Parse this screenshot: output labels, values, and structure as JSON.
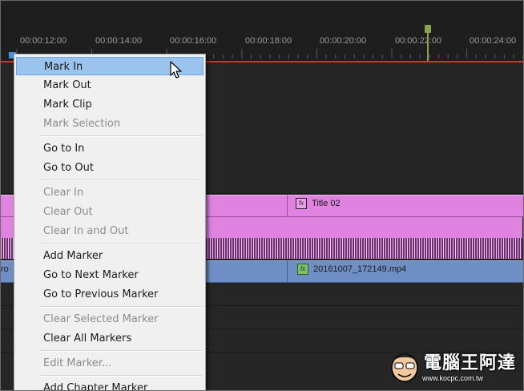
{
  "ruler": {
    "timecodes": [
      "00:00:12:00",
      "00:00:14:00",
      "00:00:16:00",
      "00:00:18:00",
      "00:00:20:00",
      "00:00:22:00",
      "00:00:24:00"
    ]
  },
  "clips": {
    "title": {
      "label": "Title 02",
      "fx": "fx"
    },
    "video": {
      "label": "20161007_172149.mp4",
      "fx": "fx",
      "left_stub": "ro"
    }
  },
  "menu": {
    "items": [
      {
        "label": "Mark In",
        "state": "highlighted"
      },
      {
        "label": "Mark Out",
        "state": "enabled"
      },
      {
        "label": "Mark Clip",
        "state": "enabled"
      },
      {
        "label": "Mark Selection",
        "state": "disabled"
      },
      {
        "label": "Go to In",
        "state": "enabled"
      },
      {
        "label": "Go to Out",
        "state": "enabled"
      },
      {
        "label": "Clear In",
        "state": "disabled"
      },
      {
        "label": "Clear Out",
        "state": "disabled"
      },
      {
        "label": "Clear In and Out",
        "state": "disabled"
      },
      {
        "label": "Add Marker",
        "state": "enabled"
      },
      {
        "label": "Go to Next Marker",
        "state": "enabled"
      },
      {
        "label": "Go to Previous Marker",
        "state": "enabled"
      },
      {
        "label": "Clear Selected Marker",
        "state": "disabled"
      },
      {
        "label": "Clear All Markers",
        "state": "enabled"
      },
      {
        "label": "Edit Marker...",
        "state": "disabled"
      },
      {
        "label": "Add Chapter Marker",
        "state": "enabled"
      }
    ]
  },
  "watermark": {
    "text": "電腦王阿達",
    "url": "www.kocpc.com.tw"
  },
  "colors": {
    "title_clip": "#e083e0",
    "video_clip": "#6f8fc4",
    "playhead": "#8aa34a",
    "in_out_line": "#c0392b",
    "menu_highlight": "#9ac4ee"
  }
}
